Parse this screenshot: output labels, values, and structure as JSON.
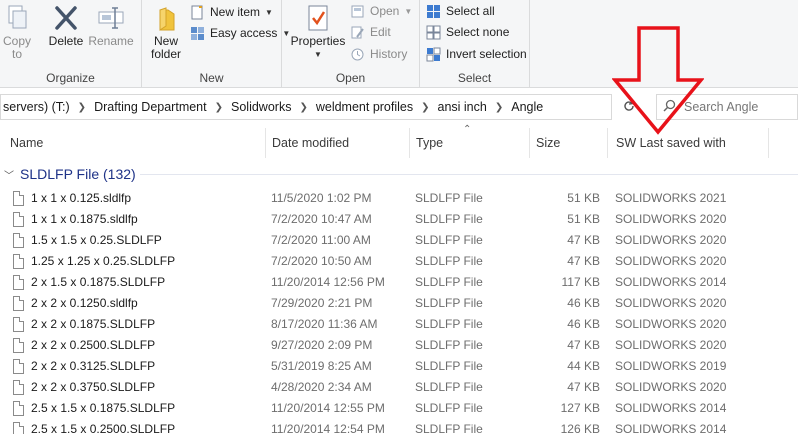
{
  "ribbon": {
    "organize": {
      "label": "Organize",
      "copy_to": "Copy\nto",
      "delete": "Delete",
      "rename": "Rename"
    },
    "new": {
      "label": "New",
      "new_folder": "New\nfolder",
      "new_item": "New item",
      "easy_access": "Easy access"
    },
    "open": {
      "label": "Open",
      "properties": "Properties",
      "open": "Open",
      "edit": "Edit",
      "history": "History"
    },
    "select": {
      "label": "Select",
      "select_all": "Select all",
      "select_none": "Select none",
      "invert_selection": "Invert selection"
    }
  },
  "address": {
    "crumbs": [
      "servers) (T:)",
      "Drafting Department",
      "Solidworks",
      "weldment profiles",
      "ansi inch",
      "Angle"
    ]
  },
  "search": {
    "placeholder": "Search Angle"
  },
  "columns": {
    "name": "Name",
    "date": "Date modified",
    "type": "Type",
    "size": "Size",
    "sw": "SW Last saved with"
  },
  "group": {
    "title": "SLDLFP File (132)"
  },
  "files": [
    {
      "name": "1 x 1 x 0.125.sldlfp",
      "date": "11/5/2020 1:02 PM",
      "type": "SLDLFP File",
      "size": "51 KB",
      "sw": "SOLIDWORKS 2021"
    },
    {
      "name": "1 x 1 x 0.1875.sldlfp",
      "date": "7/2/2020 10:47 AM",
      "type": "SLDLFP File",
      "size": "51 KB",
      "sw": "SOLIDWORKS 2020"
    },
    {
      "name": "1.5 x 1.5 x 0.25.SLDLFP",
      "date": "7/2/2020 11:00 AM",
      "type": "SLDLFP File",
      "size": "47 KB",
      "sw": "SOLIDWORKS 2020"
    },
    {
      "name": "1.25 x 1.25 x 0.25.SLDLFP",
      "date": "7/2/2020 10:50 AM",
      "type": "SLDLFP File",
      "size": "47 KB",
      "sw": "SOLIDWORKS 2020"
    },
    {
      "name": "2 x 1.5 x 0.1875.SLDLFP",
      "date": "11/20/2014 12:56 PM",
      "type": "SLDLFP File",
      "size": "117 KB",
      "sw": "SOLIDWORKS 2014"
    },
    {
      "name": "2 x 2 x 0.1250.sldlfp",
      "date": "7/29/2020 2:21 PM",
      "type": "SLDLFP File",
      "size": "46 KB",
      "sw": "SOLIDWORKS 2020"
    },
    {
      "name": "2 x 2 x 0.1875.SLDLFP",
      "date": "8/17/2020 11:36 AM",
      "type": "SLDLFP File",
      "size": "46 KB",
      "sw": "SOLIDWORKS 2020"
    },
    {
      "name": "2 x 2 x 0.2500.SLDLFP",
      "date": "9/27/2020 2:09 PM",
      "type": "SLDLFP File",
      "size": "47 KB",
      "sw": "SOLIDWORKS 2020"
    },
    {
      "name": "2 x 2 x 0.3125.SLDLFP",
      "date": "5/31/2019 8:25 AM",
      "type": "SLDLFP File",
      "size": "44 KB",
      "sw": "SOLIDWORKS 2019"
    },
    {
      "name": "2 x 2 x 0.3750.SLDLFP",
      "date": "4/28/2020 2:34 AM",
      "type": "SLDLFP File",
      "size": "47 KB",
      "sw": "SOLIDWORKS 2020"
    },
    {
      "name": "2.5 x 1.5 x 0.1875.SLDLFP",
      "date": "11/20/2014 12:55 PM",
      "type": "SLDLFP File",
      "size": "127 KB",
      "sw": "SOLIDWORKS 2014"
    },
    {
      "name": "2.5 x 1.5 x 0.2500.SLDLFP",
      "date": "11/20/2014 12:54 PM",
      "type": "SLDLFP File",
      "size": "126 KB",
      "sw": "SOLIDWORKS 2014"
    }
  ],
  "colors": {
    "group_header": "#1e3287",
    "annotation_arrow": "#e8121a",
    "folder": "#f0c33c"
  }
}
